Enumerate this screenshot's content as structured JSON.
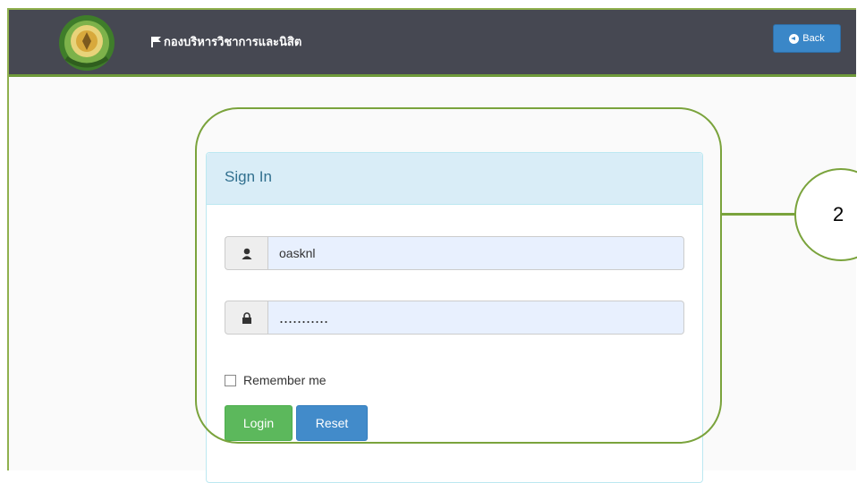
{
  "navbar": {
    "title": "กองบริหารวิชาการและนิสิต",
    "back_label": "Back",
    "bg_color": "#464852"
  },
  "login": {
    "heading": "Sign In",
    "username": "oasknl",
    "password_mask": "...........",
    "remember_label": "Remember me",
    "login_label": "Login",
    "reset_label": "Reset",
    "icons": {
      "username": "user-icon",
      "password": "lock-icon"
    }
  },
  "annotation": {
    "number": "2",
    "color": "#7aa33c"
  }
}
